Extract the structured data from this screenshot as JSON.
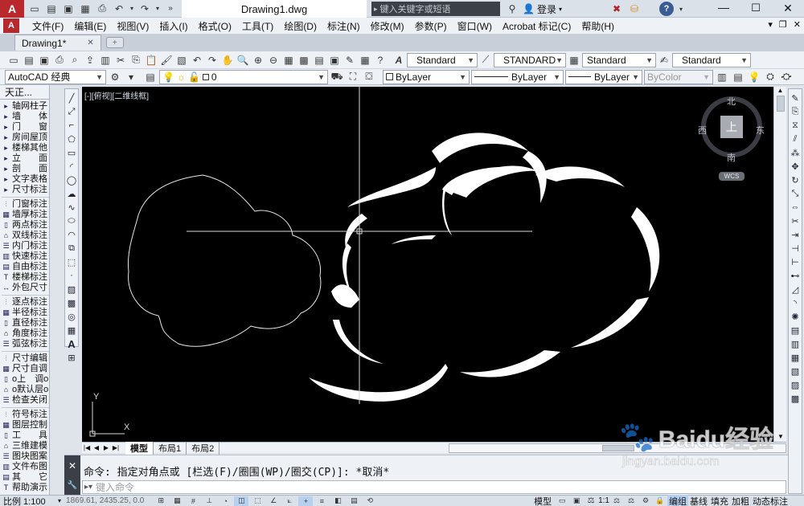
{
  "titlebar": {
    "tab_title": "Drawing1.dwg",
    "search_placeholder": "键入关键字或短语",
    "login_label": "登录"
  },
  "menubar": {
    "items": [
      "文件(F)",
      "编辑(E)",
      "视图(V)",
      "插入(I)",
      "格式(O)",
      "工具(T)",
      "绘图(D)",
      "标注(N)",
      "修改(M)",
      "参数(P)",
      "窗口(W)",
      "Acrobat 标记(C)",
      "帮助(H)"
    ]
  },
  "doc_tab": {
    "label": "Drawing1*",
    "close": "✕"
  },
  "toolbar": {
    "text_style": "Standard",
    "dim_style": "STANDARD",
    "table_style": "Standard",
    "multileader_style": "Standard"
  },
  "toolbar2": {
    "workspace": "AutoCAD 经典",
    "layer": "0",
    "color": "ByLayer",
    "linetype": "ByLayer",
    "lineweight": "ByLayer",
    "plotstyle": "ByColor"
  },
  "viewport": {
    "label": "[-][俯视][二维线框]",
    "viewcube": {
      "top": "上",
      "north": "北",
      "south": "南",
      "west": "西",
      "east": "东",
      "wcs": "WCS"
    },
    "ucs_x": "X",
    "ucs_y": "Y"
  },
  "layout_tabs": [
    "模型",
    "布局1",
    "布局2"
  ],
  "sidebar": {
    "title": "天正...",
    "groups": [
      [
        "轴网柱子",
        "墙　　体",
        "门　　窗",
        "房间屋顶",
        "楼梯其他",
        "立　　面",
        "剖　　面",
        "文字表格",
        "尺寸标注"
      ],
      [
        "门窗标注",
        "墙厚标注",
        "两点标注",
        "双线标注",
        "内门标注",
        "快速标注",
        "自由标注",
        "楼梯标注",
        "外包尺寸"
      ],
      [
        "逐点标注",
        "半径标注",
        "直径标注",
        "角度标注",
        "弧弦标注"
      ],
      [
        "尺寸编辑",
        "尺寸自调",
        "o上　调o",
        "o默认层o",
        "检查关闭"
      ],
      [
        "符号标注",
        "图层控制",
        "工　　具",
        "三维建模",
        "图块图案",
        "文件布图",
        "其　　它",
        "帮助演示"
      ]
    ]
  },
  "command": {
    "history": "命令: 指定对角点或 [栏选(F)/圈围(WP)/圈交(CP)]: *取消*",
    "placeholder": "键入命令"
  },
  "statusbar": {
    "scale": "比例 1:100",
    "coords": "1869.61, 2435.25, 0.0",
    "model": "模型",
    "annotation_scale": "1:1",
    "right_items": [
      "编组",
      "基线",
      "填充",
      "加粗",
      "动态标注"
    ]
  },
  "watermark": {
    "text": "Baidu经验",
    "url": "jingyan.baidu.com"
  }
}
